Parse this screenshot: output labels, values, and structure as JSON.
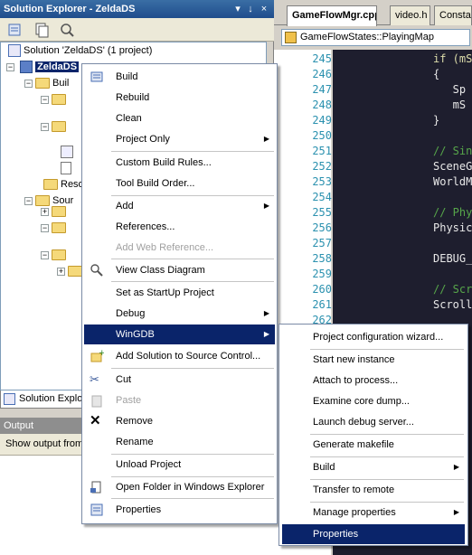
{
  "solution_explorer": {
    "title": "Solution Explorer - ZeldaDS",
    "pin_icon": "↓",
    "close_icon": "×",
    "tree": {
      "solution": "Solution 'ZeldaDS' (1 project)",
      "project": "ZeldaDS",
      "folders": [
        "Buil",
        "Reso",
        "Sour"
      ]
    },
    "tab_label": "Solution Explor"
  },
  "output": {
    "title": "Output",
    "toolbar_label": "Show output from"
  },
  "editor": {
    "tabs": [
      "GameFlowMgr.cpp",
      "video.h",
      "Constar"
    ],
    "nav_value": "GameFlowStates::PlayingMap",
    "lines": [
      {
        "n": "245",
        "text": "if (mS",
        "cls": "kw"
      },
      {
        "n": "246",
        "text": "{",
        "cls": ""
      },
      {
        "n": "247",
        "text": "   Sp",
        "cls": ""
      },
      {
        "n": "248",
        "text": "   mS",
        "cls": ""
      },
      {
        "n": "249",
        "text": "}",
        "cls": ""
      },
      {
        "n": "250",
        "text": "",
        "cls": ""
      },
      {
        "n": "251",
        "text": "// Sin",
        "cls": "cm"
      },
      {
        "n": "252",
        "text": "SceneG",
        "cls": ""
      },
      {
        "n": "253",
        "text": "WorldM",
        "cls": ""
      },
      {
        "n": "254",
        "text": "",
        "cls": ""
      },
      {
        "n": "255",
        "text": "// Phy",
        "cls": "cm"
      },
      {
        "n": "256",
        "text": "Physic",
        "cls": ""
      },
      {
        "n": "257",
        "text": "",
        "cls": ""
      },
      {
        "n": "258",
        "text": "DEBUG_",
        "cls": ""
      },
      {
        "n": "259",
        "text": "",
        "cls": ""
      },
      {
        "n": "260",
        "text": "// Scr",
        "cls": "cm"
      },
      {
        "n": "261",
        "text": "Scroll",
        "cls": ""
      },
      {
        "n": "262",
        "text": "",
        "cls": ""
      }
    ]
  },
  "context_menu": {
    "items": [
      {
        "label": "Build",
        "icon": "build-icon"
      },
      {
        "label": "Rebuild"
      },
      {
        "label": "Clean"
      },
      {
        "label": "Project Only",
        "submenu": true
      },
      {
        "label": "Custom Build Rules..."
      },
      {
        "label": "Tool Build Order..."
      },
      {
        "label": "Add",
        "submenu": true
      },
      {
        "label": "References..."
      },
      {
        "label": "Add Web Reference...",
        "disabled": true
      },
      {
        "label": "View Class Diagram",
        "icon": "class-diagram-icon"
      },
      {
        "label": "Set as StartUp Project"
      },
      {
        "label": "Debug",
        "submenu": true
      },
      {
        "label": "WinGDB",
        "submenu": true,
        "highlight": true
      },
      {
        "label": "Add Solution to Source Control...",
        "icon": "source-control-icon"
      },
      {
        "label": "Cut",
        "icon": "scissors-icon"
      },
      {
        "label": "Paste",
        "icon": "paste-icon",
        "disabled": true
      },
      {
        "label": "Remove",
        "icon": "remove-icon"
      },
      {
        "label": "Rename"
      },
      {
        "label": "Unload Project"
      },
      {
        "label": "Open Folder in Windows Explorer",
        "icon": "folder-icon"
      },
      {
        "label": "Properties",
        "icon": "properties-icon"
      }
    ]
  },
  "wingdb_submenu": {
    "items": [
      {
        "label": "Project configuration wizard..."
      },
      {
        "label": "Start new instance"
      },
      {
        "label": "Attach to process..."
      },
      {
        "label": "Examine core dump..."
      },
      {
        "label": "Launch debug server..."
      },
      {
        "label": "Generate makefile"
      },
      {
        "label": "Build",
        "submenu": true
      },
      {
        "label": "Transfer to remote"
      },
      {
        "label": "Manage properties",
        "submenu": true
      },
      {
        "label": "Properties",
        "highlight": true
      }
    ]
  },
  "colors": {
    "menu_highlight": "#0a246a",
    "editor_bg": "#1e1e2e",
    "comment": "#57a64a",
    "line_number": "#2b91af"
  }
}
